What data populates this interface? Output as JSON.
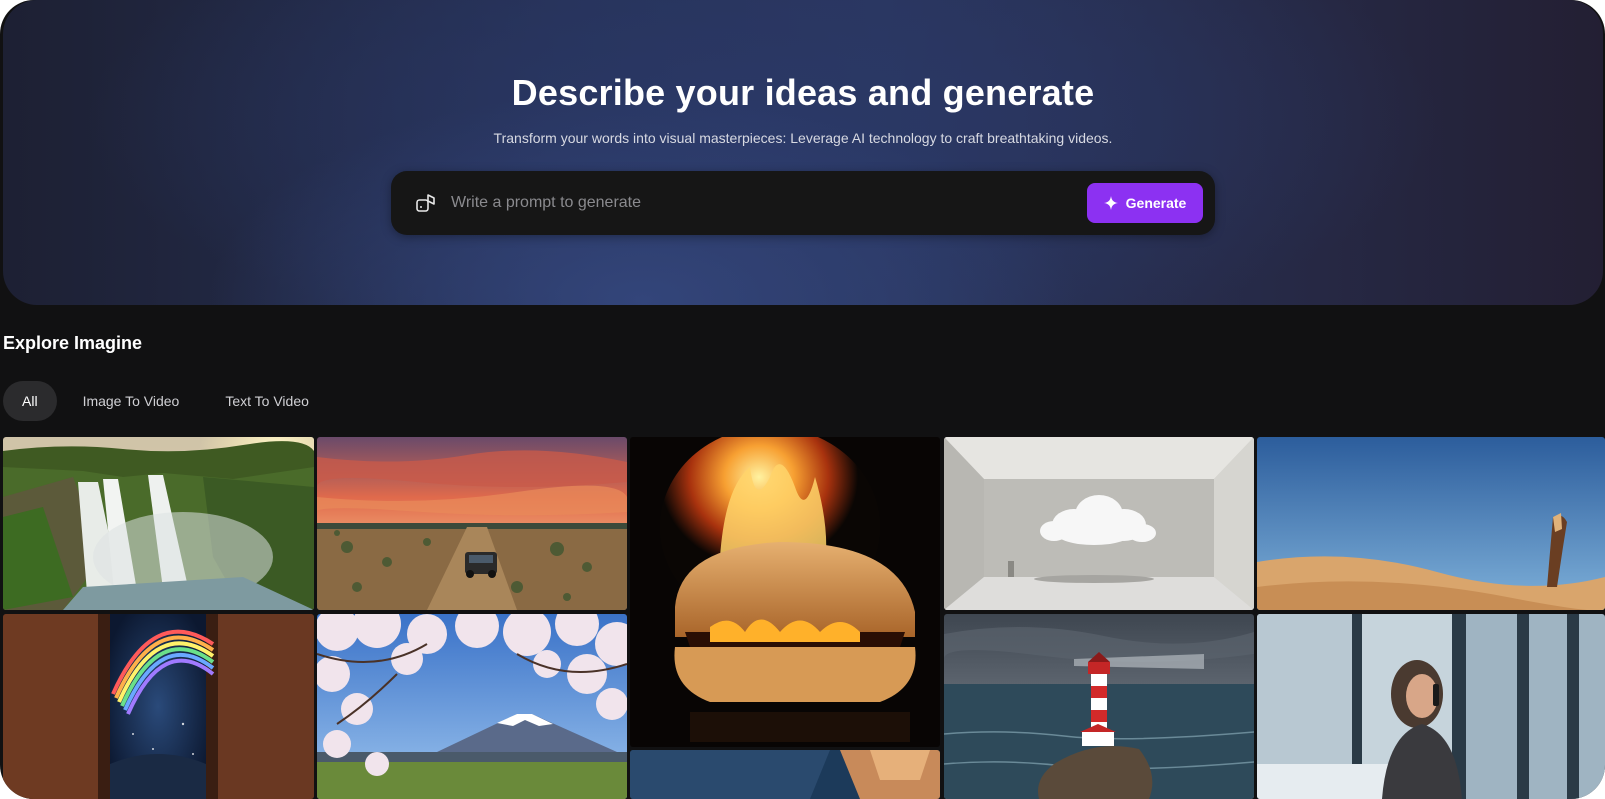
{
  "hero": {
    "title": "Describe your ideas and generate",
    "subtitle": "Transform your words into visual masterpieces: Leverage AI technology to craft breathtaking videos.",
    "prompt_placeholder": "Write a prompt to generate",
    "prompt_icon": "dice-shapes-icon",
    "generate_label": "Generate",
    "generate_icon": "sparkle-icon",
    "accent_color": "#8c31f2"
  },
  "explore": {
    "title": "Explore Imagine",
    "tabs": [
      {
        "label": "All",
        "active": true
      },
      {
        "label": "Image To Video",
        "active": false
      },
      {
        "label": "Text To Video",
        "active": false
      }
    ]
  },
  "gallery": [
    {
      "name": "waterfall-tile"
    },
    {
      "name": "desert-car-sunset-tile"
    },
    {
      "name": "burning-bread-tile"
    },
    {
      "name": "cloud-room-tile"
    },
    {
      "name": "sand-dunes-tile"
    },
    {
      "name": "rainbow-door-tile"
    },
    {
      "name": "cherry-blossom-fuji-tile"
    },
    {
      "name": "lighthouse-sea-tile"
    },
    {
      "name": "woman-phone-window-tile"
    },
    {
      "name": "abstract-bottom-tile"
    }
  ]
}
